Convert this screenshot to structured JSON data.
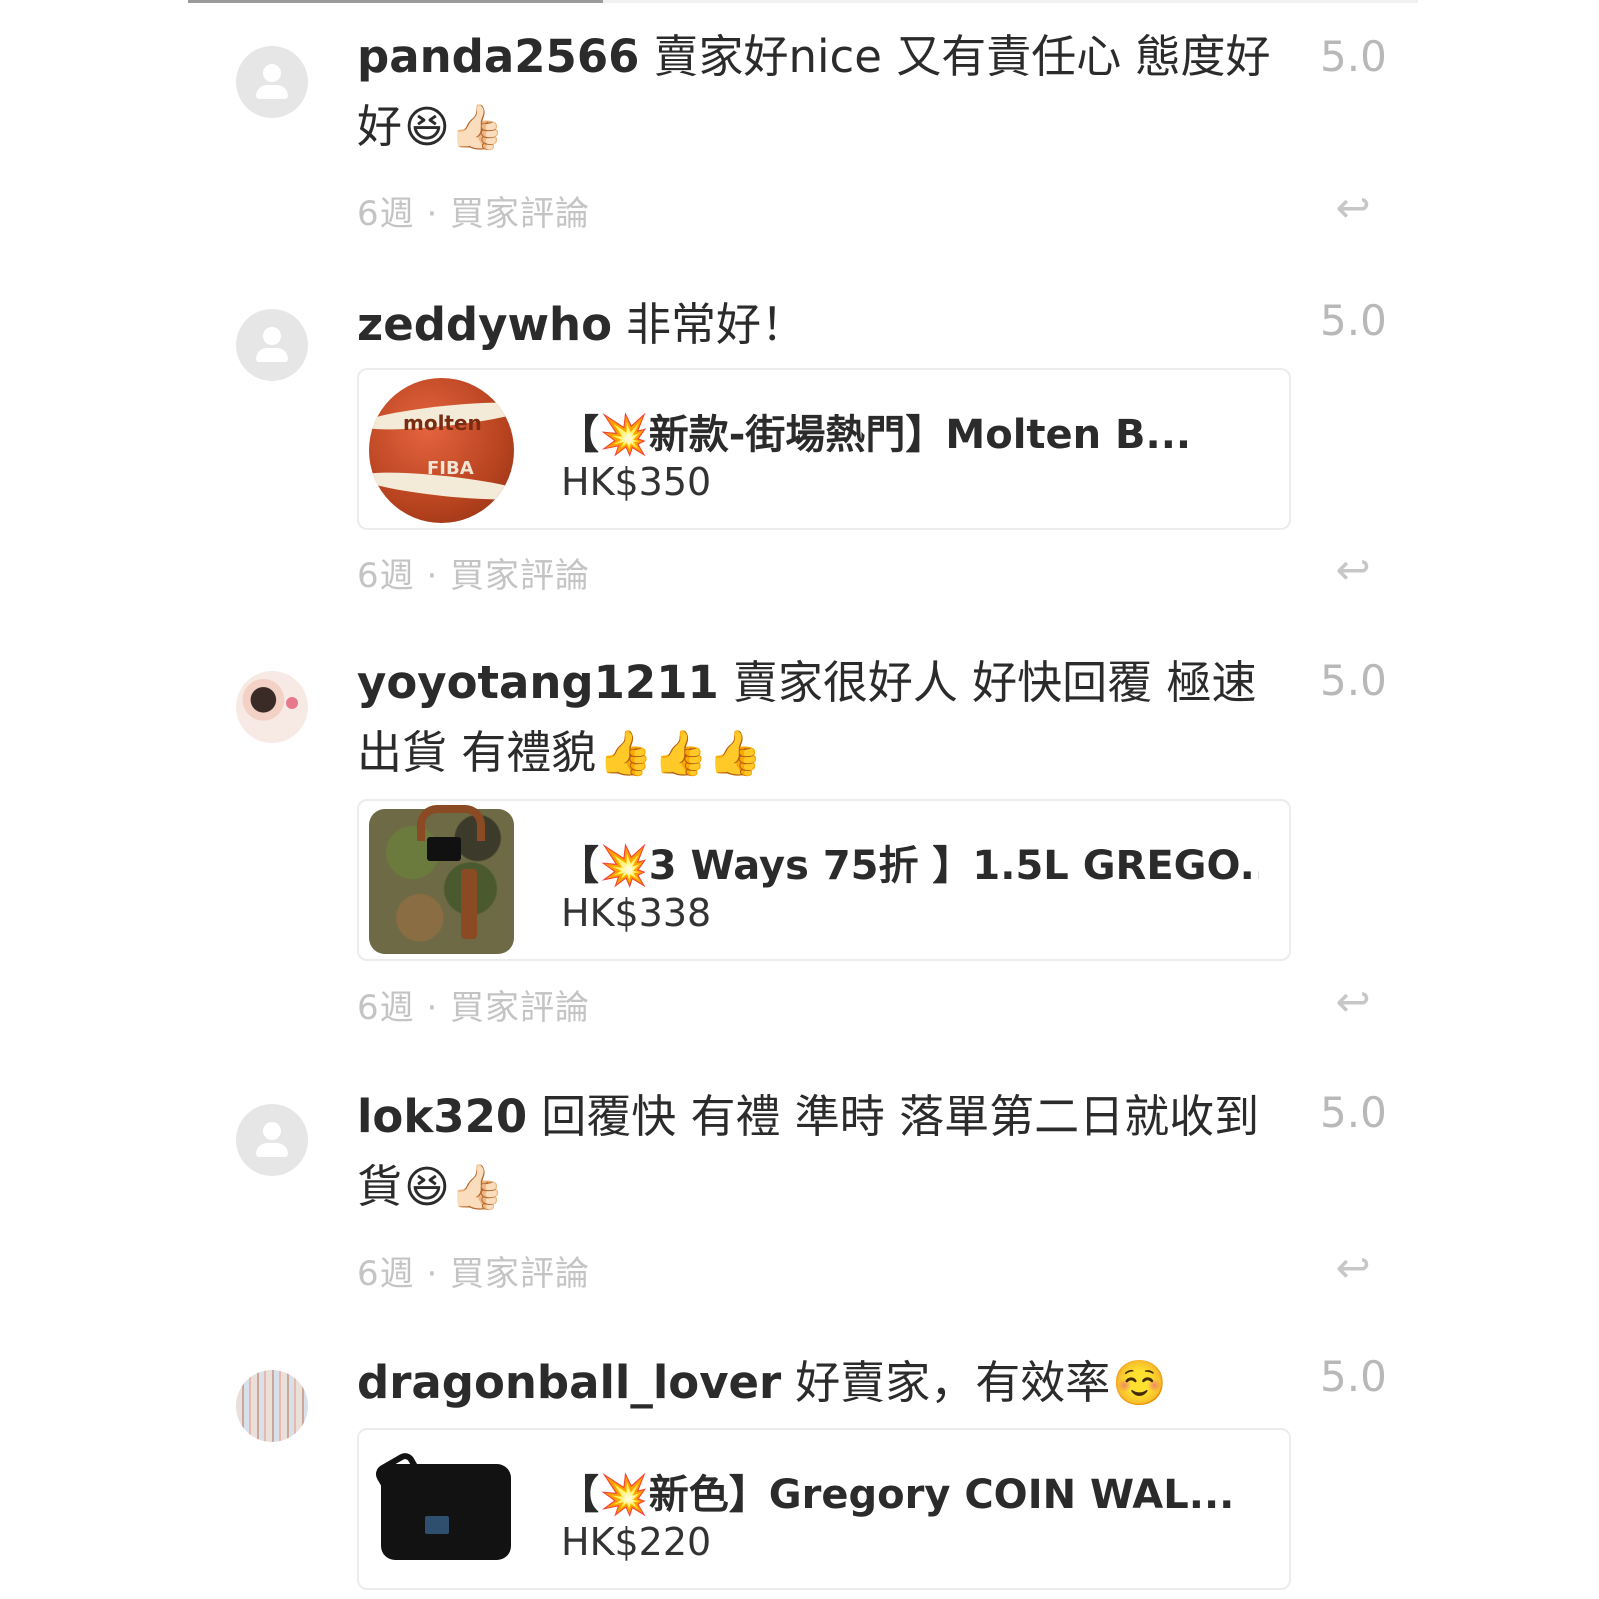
{
  "reviews": [
    {
      "username": "panda2566",
      "comment": "賣家好nice 又有責任心 態度好好",
      "emoji": "😆👍🏻",
      "rating": "5.0",
      "meta": "6週 · 買家評論",
      "avatar": "default-avatar-icon"
    },
    {
      "username": "zeddywho",
      "comment": "非常好！",
      "emoji": "",
      "rating": "5.0",
      "meta": "6週 · 買家評論",
      "avatar": "default-avatar-icon",
      "product": {
        "title": "【💥新款-街場熱門】Molten B...",
        "price": "HK$350",
        "image_labels": {
          "brand": "molten",
          "mark": "FIBA"
        }
      }
    },
    {
      "username": "yoyotang1211",
      "comment": "賣家很好人 好快回覆 極速出貨 有禮貌",
      "emoji": "👍👍👍",
      "rating": "5.0",
      "meta": "6週 · 買家評論",
      "avatar": "photo-avatar",
      "product": {
        "title": "【💥3 Ways 75折 】1.5L GREGO...",
        "price": "HK$338"
      }
    },
    {
      "username": "lok320",
      "comment": "回覆快 有禮 準時 落單第二日就收到貨",
      "emoji": "😆👍🏻",
      "rating": "5.0",
      "meta": "6週 · 買家評論",
      "avatar": "default-avatar-icon"
    },
    {
      "username": "dragonball_lover",
      "comment": "好賣家，有效率",
      "emoji": "☺️",
      "rating": "5.0",
      "avatar": "photo-avatar",
      "product": {
        "title": "【💥新色】Gregory COIN WAL...",
        "price": "HK$220"
      }
    }
  ],
  "icons": {
    "reply": "reply-arrow-icon"
  },
  "colors": {
    "text": "#2b2b2b",
    "muted": "#c4c4c4",
    "rating": "#b8b8b8",
    "avatar_bg": "#e6e6e6",
    "card_border": "#ececec"
  }
}
